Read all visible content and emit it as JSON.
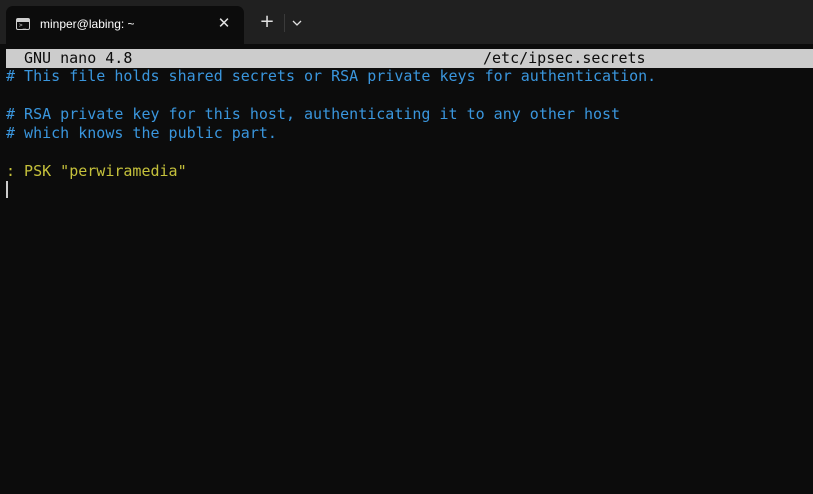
{
  "window": {
    "tab_title": "minper@labing: ~",
    "tab_icon": "terminal-icon",
    "close_glyph": "✕",
    "new_tab_glyph": "+"
  },
  "colors": {
    "titlebar": "#202020",
    "terminal_bg": "#0c0c0c",
    "comment": "#3a96dd",
    "psk": "#c5c13b",
    "header_bg": "#cccccc"
  },
  "nano": {
    "version": "GNU nano 4.8",
    "filename": "/etc/ipsec.secrets"
  },
  "content": {
    "lines": [
      "# This file holds shared secrets or RSA private keys for authentication.",
      "",
      "# RSA private key for this host, authenticating it to any other host",
      "# which knows the public part.",
      "",
      ": PSK \"perwiramedia\""
    ]
  }
}
